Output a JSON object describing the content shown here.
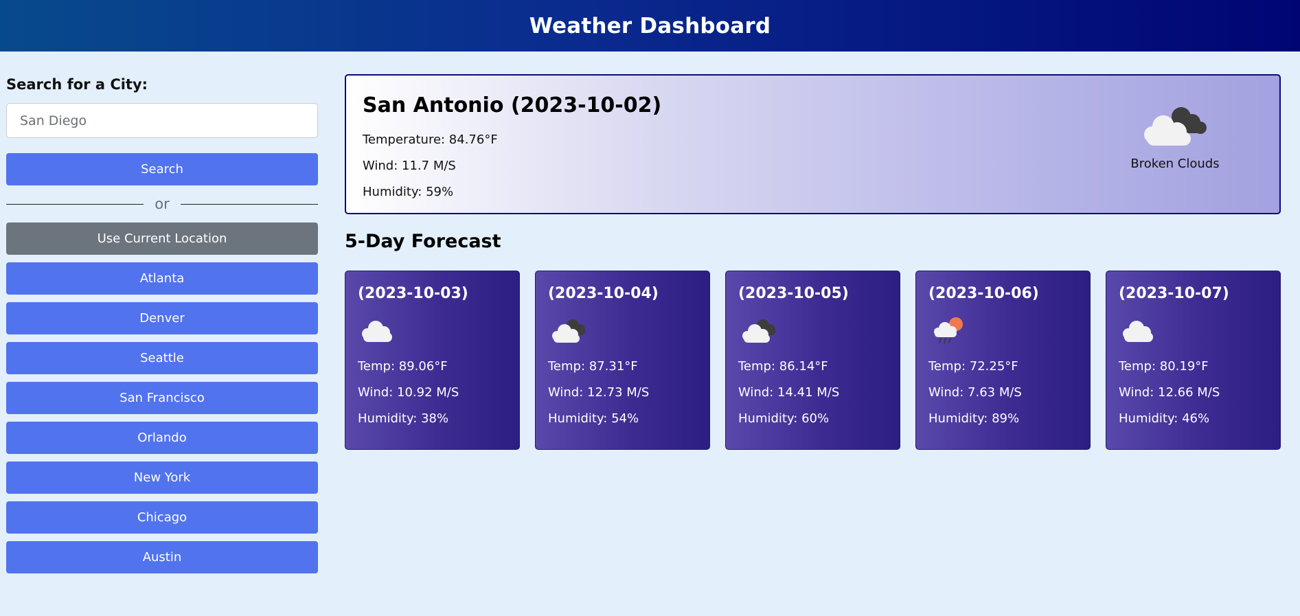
{
  "header": {
    "title": "Weather Dashboard"
  },
  "sidebar": {
    "search_label": "Search for a City:",
    "search_placeholder": "San Diego",
    "search_button": "Search",
    "divider_text": "or",
    "location_button": "Use Current Location",
    "history": [
      {
        "label": "Atlanta"
      },
      {
        "label": "Denver"
      },
      {
        "label": "Seattle"
      },
      {
        "label": "San Francisco"
      },
      {
        "label": "Orlando"
      },
      {
        "label": "New York"
      },
      {
        "label": "Chicago"
      },
      {
        "label": "Austin"
      }
    ]
  },
  "current": {
    "title": "San Antonio (2023-10-02)",
    "temperature": "Temperature: 84.76°F",
    "wind": "Wind: 11.7 M/S",
    "humidity": "Humidity: 59%",
    "icon": "broken-clouds-icon",
    "description": "Broken Clouds"
  },
  "forecast": {
    "title": "5-Day Forecast",
    "days": [
      {
        "date": "(2023-10-03)",
        "icon": "cloud-icon",
        "temp": "Temp: 89.06°F",
        "wind": "Wind: 10.92 M/S",
        "humidity": "Humidity: 38%"
      },
      {
        "date": "(2023-10-04)",
        "icon": "broken-clouds-icon",
        "temp": "Temp: 87.31°F",
        "wind": "Wind: 12.73 M/S",
        "humidity": "Humidity: 54%"
      },
      {
        "date": "(2023-10-05)",
        "icon": "broken-clouds-icon",
        "temp": "Temp: 86.14°F",
        "wind": "Wind: 14.41 M/S",
        "humidity": "Humidity: 60%"
      },
      {
        "date": "(2023-10-06)",
        "icon": "rain-sun-icon",
        "temp": "Temp: 72.25°F",
        "wind": "Wind: 7.63 M/S",
        "humidity": "Humidity: 89%"
      },
      {
        "date": "(2023-10-07)",
        "icon": "cloud-icon",
        "temp": "Temp: 80.19°F",
        "wind": "Wind: 12.66 M/S",
        "humidity": "Humidity: 46%"
      }
    ]
  },
  "colors": {
    "header_start": "#074a8c",
    "header_end": "#000574",
    "button_primary": "#5173ee",
    "button_secondary": "#6c757d",
    "card_start": "#5a49ab",
    "card_end": "#2c1e82",
    "page_bg": "#e3f0fb"
  }
}
